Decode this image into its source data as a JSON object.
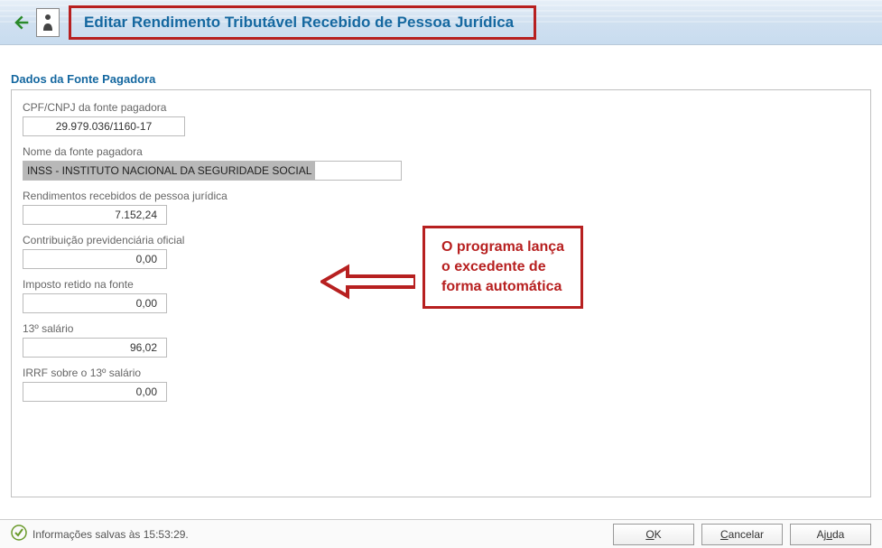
{
  "header": {
    "title": "Editar Rendimento Tributável Recebido de Pessoa Jurídica"
  },
  "section": {
    "title": "Dados da Fonte Pagadora"
  },
  "fields": {
    "cnpj": {
      "label": "CPF/CNPJ da fonte pagadora",
      "value": "29.979.036/1160-17"
    },
    "nome": {
      "label": "Nome da fonte pagadora",
      "value": "INSS - INSTITUTO NACIONAL DA SEGURIDADE SOCIAL"
    },
    "rendimentos": {
      "label": "Rendimentos recebidos de pessoa jurídica",
      "value": "7.152,24"
    },
    "contribuicao": {
      "label": "Contribuição previdenciária oficial",
      "value": "0,00"
    },
    "imposto": {
      "label": "Imposto retido na fonte",
      "value": "0,00"
    },
    "salario13": {
      "label": "13º salário",
      "value": "96,02"
    },
    "irrf13": {
      "label": "IRRF sobre o 13º salário",
      "value": "0,00"
    }
  },
  "callout": {
    "text": "O programa lança\no excedente de\nforma automática"
  },
  "status": {
    "text": "Informações salvas às 15:53:29."
  },
  "buttons": {
    "ok": "OK",
    "cancel": "Cancelar",
    "help": "Ajuda"
  }
}
